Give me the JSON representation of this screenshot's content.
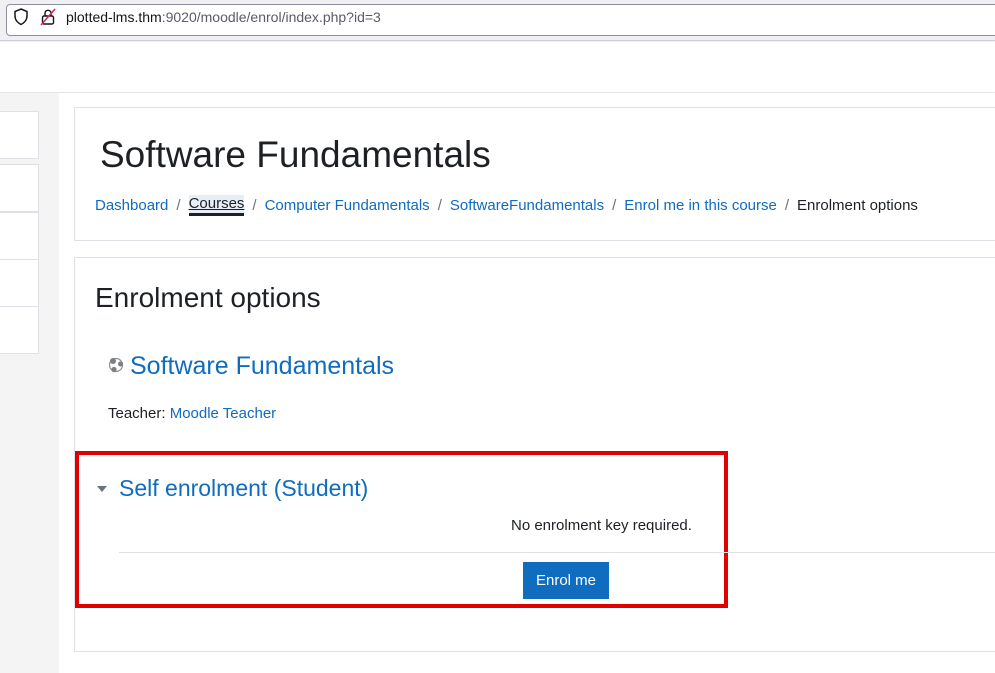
{
  "browser": {
    "url_host": "plotted-lms.thm",
    "url_rest": ":9020/moodle/enrol/index.php?id=3"
  },
  "header": {
    "title": "Software Fundamentals",
    "breadcrumb": [
      "Dashboard",
      "Courses",
      "Computer Fundamentals",
      "SoftwareFundamentals",
      "Enrol me in this course",
      "Enrolment options"
    ],
    "separator": "/"
  },
  "main": {
    "section_title": "Enrolment options",
    "course_name": "Software Fundamentals",
    "teacher_label": "Teacher: ",
    "teacher_name": "Moodle Teacher",
    "enrol_method": {
      "heading": "Self enrolment (Student)",
      "note": "No enrolment key required.",
      "button_label": "Enrol me"
    }
  },
  "colors": {
    "link": "#0f6cbf",
    "highlight": "#e00000",
    "button": "#0f6cbf"
  }
}
